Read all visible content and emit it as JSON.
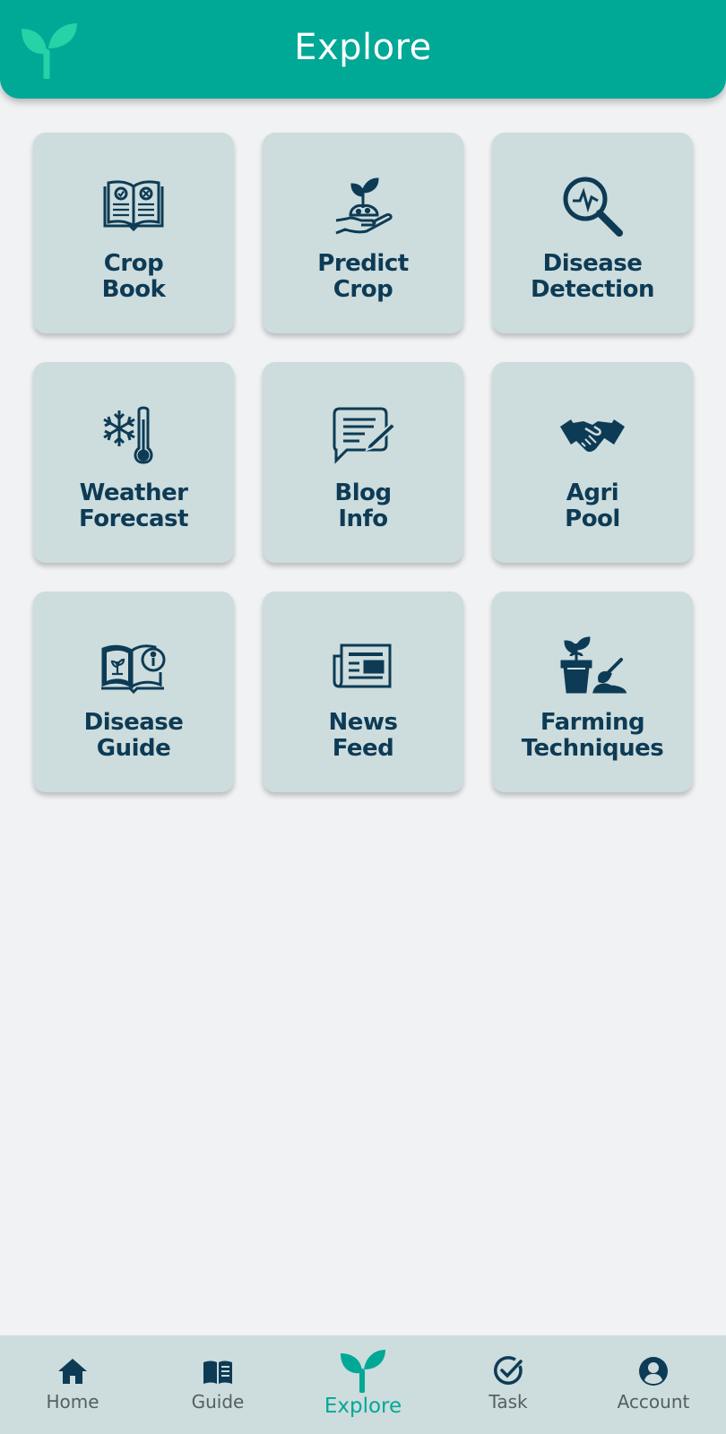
{
  "header": {
    "title": "Explore",
    "logo_icon": "sprout-icon"
  },
  "colors": {
    "brand": "#00a896",
    "tile_bg": "#cddcdd",
    "tile_text": "#0d3b55",
    "page_bg": "#f1f2f4",
    "nav_inactive": "#555e66"
  },
  "tiles": [
    {
      "line1": "Crop",
      "line2": "Book",
      "icon": "open-book-icon"
    },
    {
      "line1": "Predict",
      "line2": "Crop",
      "icon": "hand-plant-icon"
    },
    {
      "line1": "Disease",
      "line2": "Detection",
      "icon": "magnifier-pulse-icon"
    },
    {
      "line1": "Weather",
      "line2": "Forecast",
      "icon": "snow-thermometer-icon"
    },
    {
      "line1": "Blog",
      "line2": "Info",
      "icon": "message-pen-icon"
    },
    {
      "line1": "Agri",
      "line2": "Pool",
      "icon": "handshake-icon"
    },
    {
      "line1": "Disease",
      "line2": "Guide",
      "icon": "book-info-icon"
    },
    {
      "line1": "News",
      "line2": "Feed",
      "icon": "newspaper-icon"
    },
    {
      "line1": "Farming",
      "line2": "Techniques",
      "icon": "pot-trowel-icon"
    }
  ],
  "bottom_nav": [
    {
      "label": "Home",
      "icon": "home-icon",
      "active": false
    },
    {
      "label": "Guide",
      "icon": "book-icon",
      "active": false
    },
    {
      "label": "Explore",
      "icon": "sprout-icon",
      "active": true
    },
    {
      "label": "Task",
      "icon": "check-circle-icon",
      "active": false
    },
    {
      "label": "Account",
      "icon": "account-circle-icon",
      "active": false
    }
  ]
}
